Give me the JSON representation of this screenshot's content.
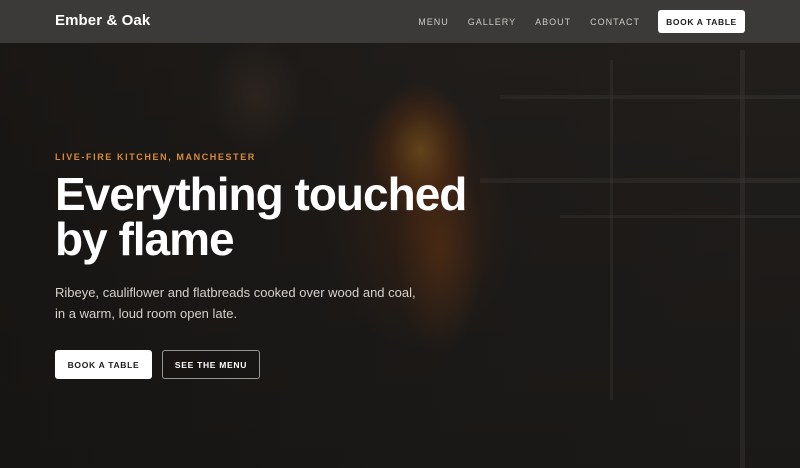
{
  "nav": {
    "brand": "Ember & Oak",
    "links": [
      {
        "label": "MENU"
      },
      {
        "label": "GALLERY"
      },
      {
        "label": "ABOUT"
      },
      {
        "label": "CONTACT"
      }
    ],
    "cta_label": "BOOK A TABLE"
  },
  "hero": {
    "kicker": "LIVE-FIRE KITCHEN, MANCHESTER",
    "headline": "Everything touched by flame",
    "lede": "Ribeye, cauliflower and flatbreads cooked over wood and coal, in a warm, loud room open late.",
    "primary_cta": "BOOK A TABLE",
    "secondary_cta": "SEE THE MENU"
  },
  "colors": {
    "nav_bg": "#3b3a38",
    "accent": "#d98a3a",
    "text_primary": "#ffffff"
  }
}
